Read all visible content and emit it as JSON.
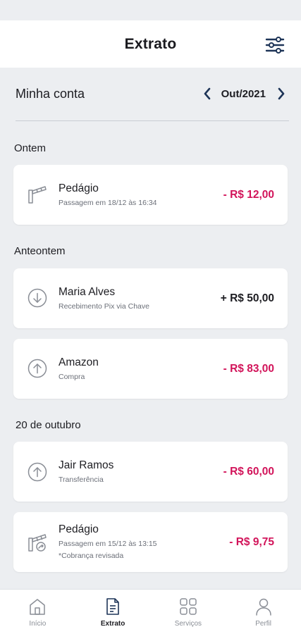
{
  "header": {
    "title": "Extrato",
    "filter_icon": "sliders-icon"
  },
  "account": {
    "label": "Minha conta",
    "month": "Out/2021"
  },
  "sections": [
    {
      "label": "Ontem"
    },
    {
      "label": "Anteontem"
    },
    {
      "label": "20 de outubro"
    }
  ],
  "transactions": [
    {
      "icon": "toll-barrier-icon",
      "title": "Pedágio",
      "subtitle": "Passagem em 18/12 às 16:34",
      "amount": "- R$ 12,00",
      "kind": "debit"
    },
    {
      "icon": "arrow-down-circle-icon",
      "title": "Maria Alves",
      "subtitle": "Recebimento Pix via Chave",
      "amount": "+ R$ 50,00",
      "kind": "credit"
    },
    {
      "icon": "arrow-up-circle-icon",
      "title": "Amazon",
      "subtitle": "Compra",
      "amount": "- R$ 83,00",
      "kind": "debit"
    },
    {
      "icon": "arrow-up-circle-icon",
      "title": "Jair Ramos",
      "subtitle": "Transferência",
      "amount": "- R$ 60,00",
      "kind": "debit"
    },
    {
      "icon": "toll-barrier-revised-icon",
      "title": "Pedágio",
      "subtitle": "Passagem em 15/12 às 13:15",
      "note": "*Cobrança revisada",
      "amount": "- R$ 9,75",
      "kind": "debit"
    }
  ],
  "bottom_nav": [
    {
      "label": "Início",
      "icon": "home-icon",
      "active": false
    },
    {
      "label": "Extrato",
      "icon": "statement-icon",
      "active": true
    },
    {
      "label": "Serviços",
      "icon": "grid-icon",
      "active": false
    },
    {
      "label": "Perfil",
      "icon": "user-icon",
      "active": false
    }
  ],
  "colors": {
    "debit": "#d2145a",
    "credit": "#1d1d22",
    "brand": "#1e3558",
    "background": "#eceef1"
  }
}
